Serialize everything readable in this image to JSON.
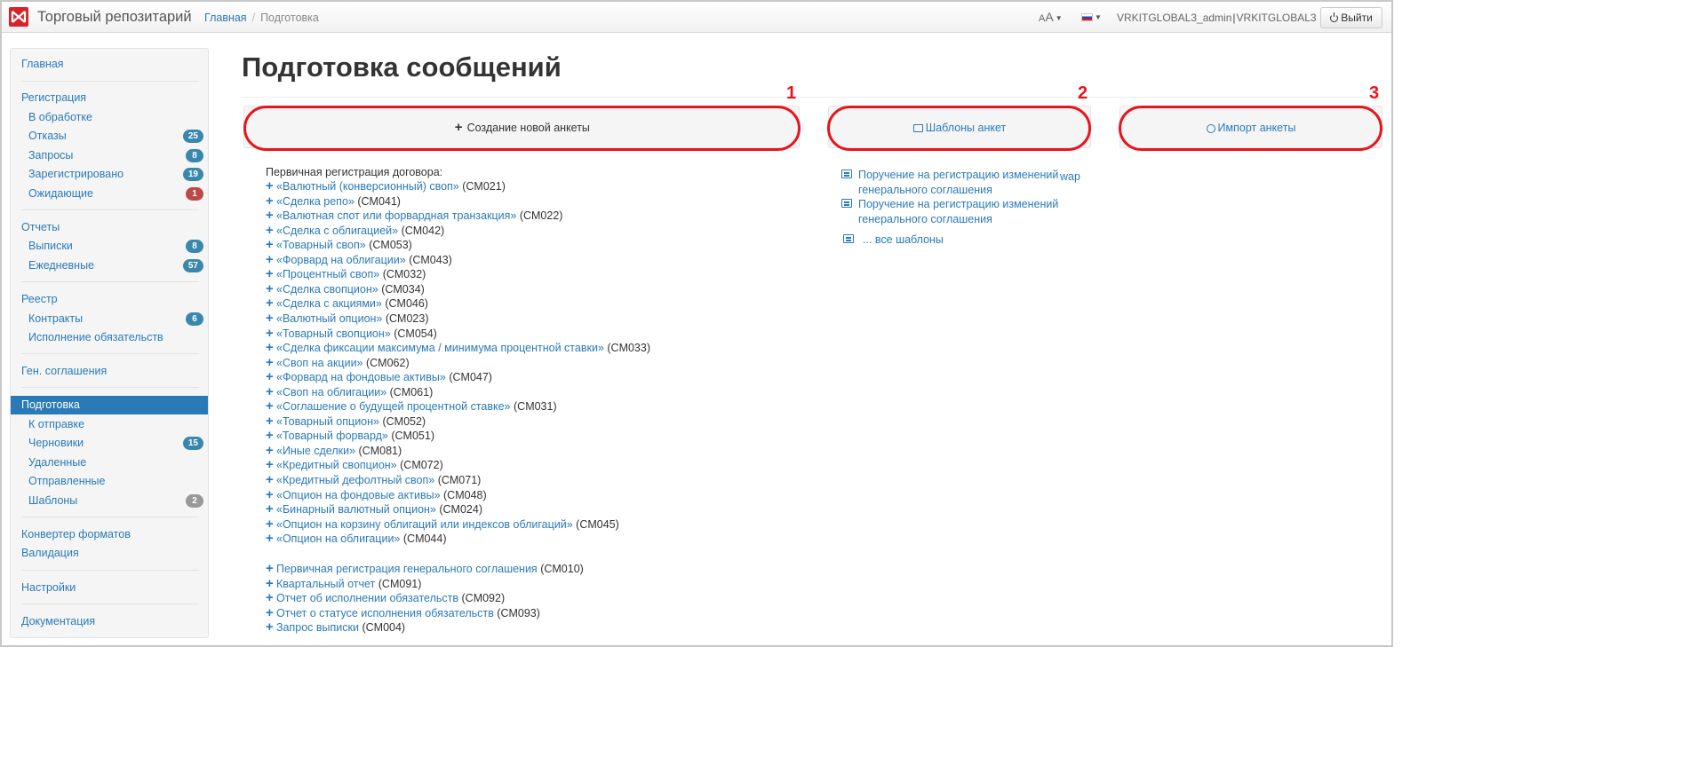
{
  "app": {
    "title": "Торговый репозитарий"
  },
  "breadcrumb": {
    "home": "Главная",
    "current": "Подготовка"
  },
  "header": {
    "font_control": "AA",
    "user": "VRKITGLOBAL3_admin",
    "org": "VRKITGLOBAL3",
    "logout_label": "Выйти"
  },
  "sidebar": {
    "items": [
      {
        "label": "Главная"
      },
      {
        "label": "Регистрация"
      },
      {
        "label": "В обработке"
      },
      {
        "label": "Отказы",
        "badge": "25"
      },
      {
        "label": "Запросы",
        "badge": "8"
      },
      {
        "label": "Зарегистрировано",
        "badge": "19"
      },
      {
        "label": "Ожидающие",
        "badge": "1"
      },
      {
        "label": "Отчеты"
      },
      {
        "label": "Выписки",
        "badge": "8"
      },
      {
        "label": "Ежедневные",
        "badge": "57"
      },
      {
        "label": "Реестр"
      },
      {
        "label": "Контракты",
        "badge": "6"
      },
      {
        "label": "Исполнение обязательств"
      },
      {
        "label": "Ген. соглашения"
      },
      {
        "label": "Подготовка"
      },
      {
        "label": "К отправке"
      },
      {
        "label": "Черновики",
        "badge": "15"
      },
      {
        "label": "Удаленные"
      },
      {
        "label": "Отправленные"
      },
      {
        "label": "Шаблоны",
        "badge": "2"
      },
      {
        "label": "Конвертер форматов"
      },
      {
        "label": "Валидация"
      },
      {
        "label": "Настройки"
      },
      {
        "label": "Документация"
      }
    ]
  },
  "main": {
    "title": "Подготовка сообщений",
    "buttons": {
      "create": "Создание новой анкеты",
      "templates": "Шаблоны анкет",
      "import": "Импорт анкеты"
    },
    "markers": [
      "1",
      "2",
      "3"
    ],
    "registration_caption": "Первичная регистрация договора:",
    "contract_types": [
      {
        "label": "«Валютный (конверсионный) своп»",
        "code": "(CM021)"
      },
      {
        "label": "«Сделка репо»",
        "code": "(CM041)"
      },
      {
        "label": "«Валютная спот или форвардная транзакция»",
        "code": "(CM022)"
      },
      {
        "label": "«Сделка с облигацией»",
        "code": "(CM042)"
      },
      {
        "label": "«Товарный своп»",
        "code": "(CM053)"
      },
      {
        "label": "«Форвард на облигации»",
        "code": "(CM043)"
      },
      {
        "label": "«Процентный своп»",
        "code": "(CM032)"
      },
      {
        "label": "«Сделка свопцион»",
        "code": "(CM034)"
      },
      {
        "label": "«Сделка с акциями»",
        "code": "(CM046)"
      },
      {
        "label": "«Валютный опцион»",
        "code": "(CM023)"
      },
      {
        "label": "«Товарный свопцион»",
        "code": "(CM054)"
      },
      {
        "label": "«Сделка фиксации максимума / минимума процентной ставки»",
        "code": "(CM033)"
      },
      {
        "label": "«Своп на акции»",
        "code": "(CM062)"
      },
      {
        "label": "«Форвард на фондовые активы»",
        "code": "(CM047)"
      },
      {
        "label": "«Своп на облигации»",
        "code": "(CM061)"
      },
      {
        "label": "«Соглашение о будущей процентной ставке»",
        "code": "(CM031)"
      },
      {
        "label": "«Товарный опцион»",
        "code": "(CM052)"
      },
      {
        "label": "«Товарный форвард»",
        "code": "(CM051)"
      },
      {
        "label": "«Иные сделки»",
        "code": "(CM081)"
      },
      {
        "label": "«Кредитный свопцион»",
        "code": "(CM072)"
      },
      {
        "label": "«Кредитный дефолтный своп»",
        "code": "(CM071)"
      },
      {
        "label": "«Опцион на фондовые активы»",
        "code": "(CM048)"
      },
      {
        "label": "«Бинарный валютный опцион»",
        "code": "(CM024)"
      },
      {
        "label": "«Опцион на корзину облигаций или индексов облигаций»",
        "code": "(CM045)"
      },
      {
        "label": "«Опцион на облигации»",
        "code": "(CM044)"
      }
    ],
    "other_forms": [
      {
        "label": "Первичная регистрация генерального соглашения",
        "code": "(CM010)"
      },
      {
        "label": "Квартальный отчет",
        "code": "(CM091)"
      },
      {
        "label": "Отчет об исполнении обязательств",
        "code": "(CM092)"
      },
      {
        "label": "Отчет о статусе исполнения обязательств",
        "code": "(CM093)"
      },
      {
        "label": "Запрос выписки",
        "code": "(CM004)"
      }
    ],
    "templates": [
      {
        "label": "Поручение на регистрацию изменений генерального соглашения"
      },
      {
        "label": "Поручение на регистрацию изменений генерального соглашения"
      }
    ],
    "templates_extra": "wap",
    "all_templates": "... все шаблоны"
  },
  "colors": {
    "brand_red": "#d8232a",
    "link": "#2a7ab8",
    "active_bg": "#2a7ab8",
    "annotation_red": "#e8141b",
    "badge_blue": "#3a87ad",
    "badge_red": "#b94a48",
    "badge_gray": "#999999"
  }
}
